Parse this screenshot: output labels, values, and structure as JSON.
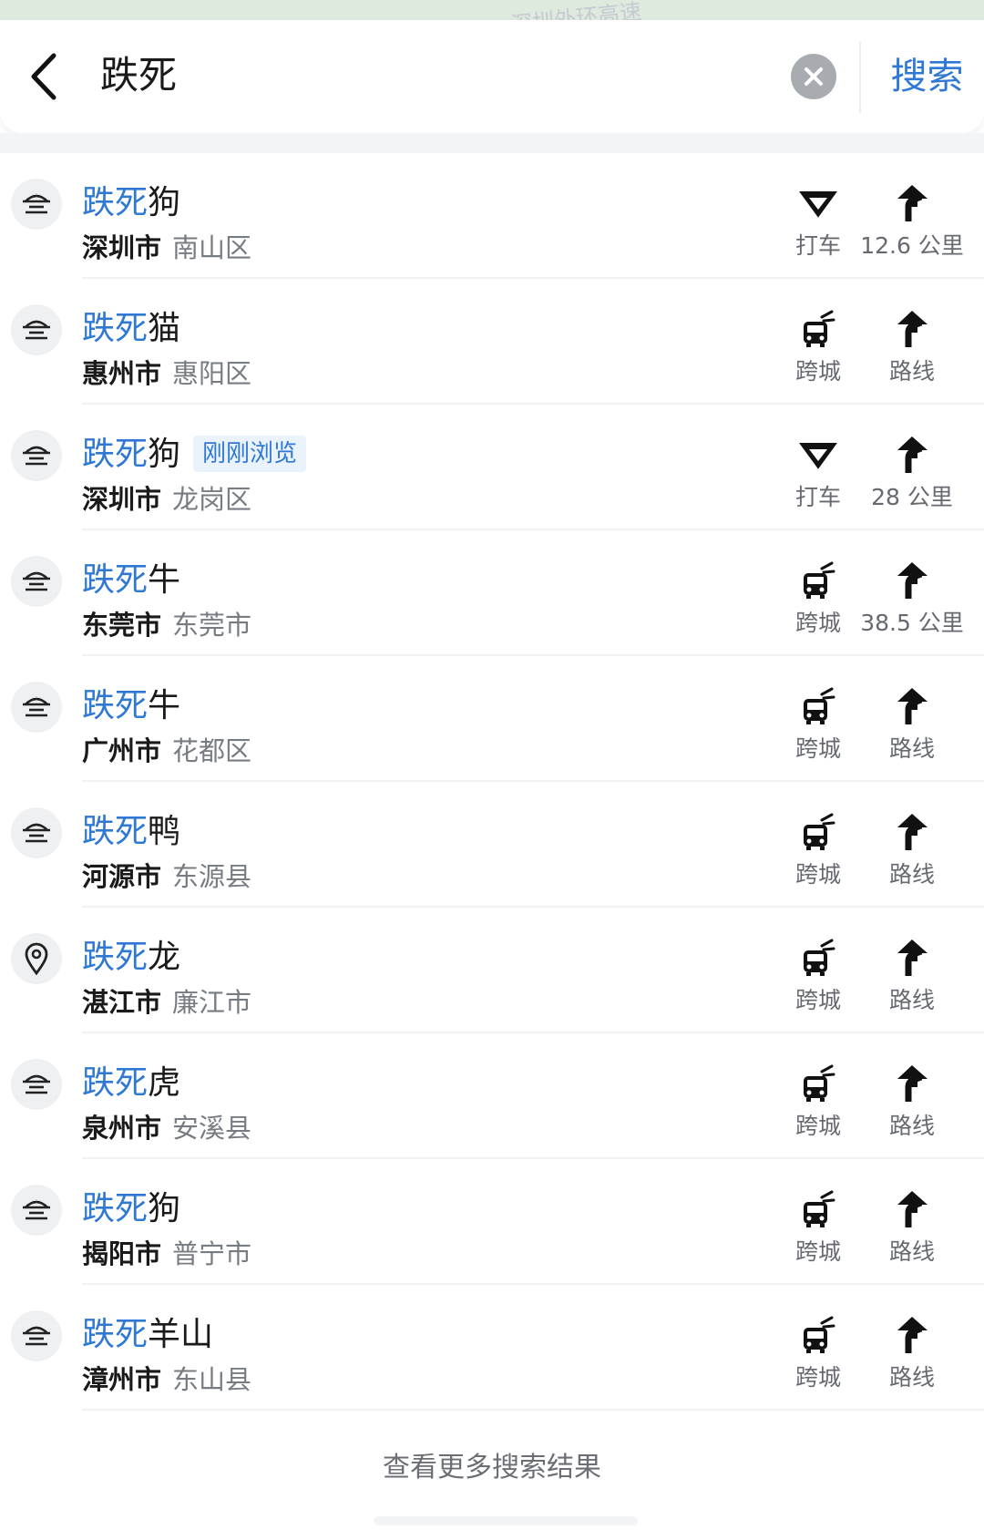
{
  "map": {
    "road_label": "深圳外环高速"
  },
  "search": {
    "query": "跌死",
    "submit_label": "搜索"
  },
  "results": [
    {
      "highlight": "跌死",
      "rest": "狗",
      "tag": "",
      "city": "深圳市",
      "district": "南山区",
      "icon": "park-icon",
      "action1": {
        "icon": "taxi-icon",
        "label": "打车"
      },
      "action2": {
        "icon": "route-arrow-icon",
        "label": "12.6 公里"
      }
    },
    {
      "highlight": "跌死",
      "rest": "猫",
      "tag": "",
      "city": "惠州市",
      "district": "惠阳区",
      "icon": "park-icon",
      "action1": {
        "icon": "intercity-bus-icon",
        "label": "跨城"
      },
      "action2": {
        "icon": "route-arrow-icon",
        "label": "路线"
      }
    },
    {
      "highlight": "跌死",
      "rest": "狗",
      "tag": "刚刚浏览",
      "city": "深圳市",
      "district": "龙岗区",
      "icon": "park-icon",
      "action1": {
        "icon": "taxi-icon",
        "label": "打车"
      },
      "action2": {
        "icon": "route-arrow-icon",
        "label": "28 公里"
      }
    },
    {
      "highlight": "跌死",
      "rest": "牛",
      "tag": "",
      "city": "东莞市",
      "district": "东莞市",
      "icon": "park-icon",
      "action1": {
        "icon": "intercity-bus-icon",
        "label": "跨城"
      },
      "action2": {
        "icon": "route-arrow-icon",
        "label": "38.5 公里"
      }
    },
    {
      "highlight": "跌死",
      "rest": "牛",
      "tag": "",
      "city": "广州市",
      "district": "花都区",
      "icon": "park-icon",
      "action1": {
        "icon": "intercity-bus-icon",
        "label": "跨城"
      },
      "action2": {
        "icon": "route-arrow-icon",
        "label": "路线"
      }
    },
    {
      "highlight": "跌死",
      "rest": "鸭",
      "tag": "",
      "city": "河源市",
      "district": "东源县",
      "icon": "park-icon",
      "action1": {
        "icon": "intercity-bus-icon",
        "label": "跨城"
      },
      "action2": {
        "icon": "route-arrow-icon",
        "label": "路线"
      }
    },
    {
      "highlight": "跌死",
      "rest": "龙",
      "tag": "",
      "city": "湛江市",
      "district": "廉江市",
      "icon": "location-pin-icon",
      "action1": {
        "icon": "intercity-bus-icon",
        "label": "跨城"
      },
      "action2": {
        "icon": "route-arrow-icon",
        "label": "路线"
      }
    },
    {
      "highlight": "跌死",
      "rest": "虎",
      "tag": "",
      "city": "泉州市",
      "district": "安溪县",
      "icon": "park-icon",
      "action1": {
        "icon": "intercity-bus-icon",
        "label": "跨城"
      },
      "action2": {
        "icon": "route-arrow-icon",
        "label": "路线"
      }
    },
    {
      "highlight": "跌死",
      "rest": "狗",
      "tag": "",
      "city": "揭阳市",
      "district": "普宁市",
      "icon": "park-icon",
      "action1": {
        "icon": "intercity-bus-icon",
        "label": "跨城"
      },
      "action2": {
        "icon": "route-arrow-icon",
        "label": "路线"
      }
    },
    {
      "highlight": "跌死",
      "rest": "羊山",
      "tag": "",
      "city": "漳州市",
      "district": "东山县",
      "icon": "park-icon",
      "action1": {
        "icon": "intercity-bus-icon",
        "label": "跨城"
      },
      "action2": {
        "icon": "route-arrow-icon",
        "label": "路线"
      }
    }
  ],
  "more_results_label": "查看更多搜索结果",
  "colors": {
    "accent": "#2f78d4",
    "tag_bg": "#eaf2fc",
    "secondary_text": "#777c82"
  }
}
